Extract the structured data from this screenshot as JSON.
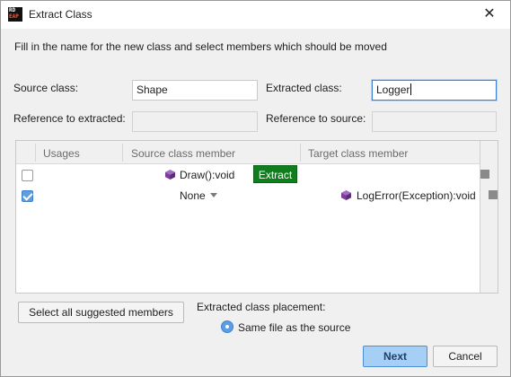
{
  "window": {
    "title": "Extract Class",
    "app_icon_line1": "RD",
    "app_icon_line2": "EAP",
    "close_glyph": "✕"
  },
  "instruction": "Fill in the name for the new class and select members which should be moved",
  "form": {
    "source_class_label": "Source class:",
    "source_class_value": "Shape",
    "extracted_class_label": "Extracted class:",
    "extracted_class_value": "Logger",
    "reference_to_extracted_label": "Reference to extracted:",
    "reference_to_extracted_value": "",
    "reference_to_source_label": "Reference to source:",
    "reference_to_source_value": ""
  },
  "grid": {
    "columns": [
      "Usages",
      "Source class member",
      "Target class member"
    ],
    "rows": [
      {
        "checked": false,
        "source_member": "Draw():void",
        "source_icon": "method-cube-icon",
        "action_label": "Extract",
        "target_member": ""
      },
      {
        "checked": true,
        "source_member": "None",
        "target_icon": "method-cube-icon",
        "target_member": "LogError(Exception):void"
      }
    ]
  },
  "buttons": {
    "select_all": "Select all suggested members",
    "next": "Next",
    "cancel": "Cancel"
  },
  "placement": {
    "label": "Extracted class placement:",
    "selected_option": "Same file as the source"
  },
  "colors": {
    "extract_button": "#0f7e1c",
    "accent": "#3c82d0",
    "icon_purple": "#7b3f9a"
  }
}
